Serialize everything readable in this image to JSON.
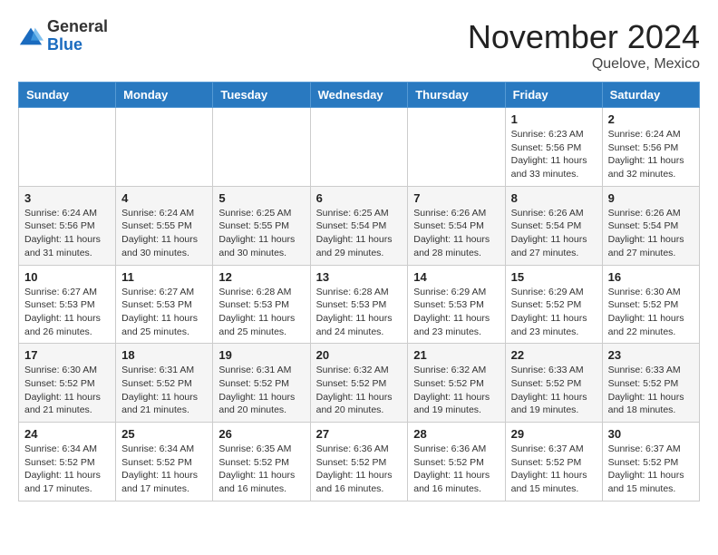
{
  "header": {
    "logo_line1": "General",
    "logo_line2": "Blue",
    "month": "November 2024",
    "location": "Quelove, Mexico"
  },
  "weekdays": [
    "Sunday",
    "Monday",
    "Tuesday",
    "Wednesday",
    "Thursday",
    "Friday",
    "Saturday"
  ],
  "weeks": [
    [
      {
        "day": "",
        "info": ""
      },
      {
        "day": "",
        "info": ""
      },
      {
        "day": "",
        "info": ""
      },
      {
        "day": "",
        "info": ""
      },
      {
        "day": "",
        "info": ""
      },
      {
        "day": "1",
        "info": "Sunrise: 6:23 AM\nSunset: 5:56 PM\nDaylight: 11 hours and 33 minutes."
      },
      {
        "day": "2",
        "info": "Sunrise: 6:24 AM\nSunset: 5:56 PM\nDaylight: 11 hours and 32 minutes."
      }
    ],
    [
      {
        "day": "3",
        "info": "Sunrise: 6:24 AM\nSunset: 5:56 PM\nDaylight: 11 hours and 31 minutes."
      },
      {
        "day": "4",
        "info": "Sunrise: 6:24 AM\nSunset: 5:55 PM\nDaylight: 11 hours and 30 minutes."
      },
      {
        "day": "5",
        "info": "Sunrise: 6:25 AM\nSunset: 5:55 PM\nDaylight: 11 hours and 30 minutes."
      },
      {
        "day": "6",
        "info": "Sunrise: 6:25 AM\nSunset: 5:54 PM\nDaylight: 11 hours and 29 minutes."
      },
      {
        "day": "7",
        "info": "Sunrise: 6:26 AM\nSunset: 5:54 PM\nDaylight: 11 hours and 28 minutes."
      },
      {
        "day": "8",
        "info": "Sunrise: 6:26 AM\nSunset: 5:54 PM\nDaylight: 11 hours and 27 minutes."
      },
      {
        "day": "9",
        "info": "Sunrise: 6:26 AM\nSunset: 5:54 PM\nDaylight: 11 hours and 27 minutes."
      }
    ],
    [
      {
        "day": "10",
        "info": "Sunrise: 6:27 AM\nSunset: 5:53 PM\nDaylight: 11 hours and 26 minutes."
      },
      {
        "day": "11",
        "info": "Sunrise: 6:27 AM\nSunset: 5:53 PM\nDaylight: 11 hours and 25 minutes."
      },
      {
        "day": "12",
        "info": "Sunrise: 6:28 AM\nSunset: 5:53 PM\nDaylight: 11 hours and 25 minutes."
      },
      {
        "day": "13",
        "info": "Sunrise: 6:28 AM\nSunset: 5:53 PM\nDaylight: 11 hours and 24 minutes."
      },
      {
        "day": "14",
        "info": "Sunrise: 6:29 AM\nSunset: 5:53 PM\nDaylight: 11 hours and 23 minutes."
      },
      {
        "day": "15",
        "info": "Sunrise: 6:29 AM\nSunset: 5:52 PM\nDaylight: 11 hours and 23 minutes."
      },
      {
        "day": "16",
        "info": "Sunrise: 6:30 AM\nSunset: 5:52 PM\nDaylight: 11 hours and 22 minutes."
      }
    ],
    [
      {
        "day": "17",
        "info": "Sunrise: 6:30 AM\nSunset: 5:52 PM\nDaylight: 11 hours and 21 minutes."
      },
      {
        "day": "18",
        "info": "Sunrise: 6:31 AM\nSunset: 5:52 PM\nDaylight: 11 hours and 21 minutes."
      },
      {
        "day": "19",
        "info": "Sunrise: 6:31 AM\nSunset: 5:52 PM\nDaylight: 11 hours and 20 minutes."
      },
      {
        "day": "20",
        "info": "Sunrise: 6:32 AM\nSunset: 5:52 PM\nDaylight: 11 hours and 20 minutes."
      },
      {
        "day": "21",
        "info": "Sunrise: 6:32 AM\nSunset: 5:52 PM\nDaylight: 11 hours and 19 minutes."
      },
      {
        "day": "22",
        "info": "Sunrise: 6:33 AM\nSunset: 5:52 PM\nDaylight: 11 hours and 19 minutes."
      },
      {
        "day": "23",
        "info": "Sunrise: 6:33 AM\nSunset: 5:52 PM\nDaylight: 11 hours and 18 minutes."
      }
    ],
    [
      {
        "day": "24",
        "info": "Sunrise: 6:34 AM\nSunset: 5:52 PM\nDaylight: 11 hours and 17 minutes."
      },
      {
        "day": "25",
        "info": "Sunrise: 6:34 AM\nSunset: 5:52 PM\nDaylight: 11 hours and 17 minutes."
      },
      {
        "day": "26",
        "info": "Sunrise: 6:35 AM\nSunset: 5:52 PM\nDaylight: 11 hours and 16 minutes."
      },
      {
        "day": "27",
        "info": "Sunrise: 6:36 AM\nSunset: 5:52 PM\nDaylight: 11 hours and 16 minutes."
      },
      {
        "day": "28",
        "info": "Sunrise: 6:36 AM\nSunset: 5:52 PM\nDaylight: 11 hours and 16 minutes."
      },
      {
        "day": "29",
        "info": "Sunrise: 6:37 AM\nSunset: 5:52 PM\nDaylight: 11 hours and 15 minutes."
      },
      {
        "day": "30",
        "info": "Sunrise: 6:37 AM\nSunset: 5:52 PM\nDaylight: 11 hours and 15 minutes."
      }
    ]
  ]
}
